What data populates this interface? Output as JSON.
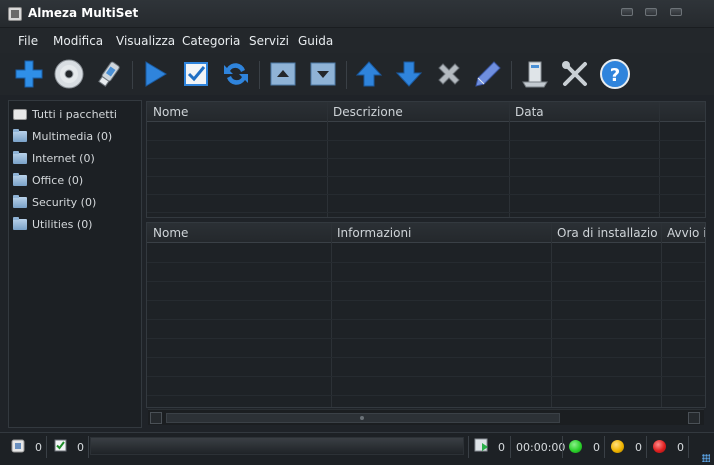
{
  "window": {
    "title": "Almeza MultiSet"
  },
  "menu": [
    "File",
    "Modifica",
    "Visualizza",
    "Categoria",
    "Servizi",
    "Guida"
  ],
  "toolbar": {
    "buttons": [
      "add-icon",
      "cd-icon",
      "usb-icon",
      "play-icon",
      "checkbox-icon",
      "refresh-icon",
      "move-top-icon",
      "move-bottom-icon",
      "arrow-up-icon",
      "arrow-down-icon",
      "delete-icon",
      "edit-icon",
      "computer-icon",
      "tools-icon",
      "help-icon"
    ]
  },
  "sidebar": {
    "items": [
      {
        "label": "Tutti i pacchetti",
        "icon": "package-icon"
      },
      {
        "label": "Multimedia (0)",
        "icon": "folder-icon"
      },
      {
        "label": "Internet (0)",
        "icon": "folder-icon"
      },
      {
        "label": "Office (0)",
        "icon": "folder-icon"
      },
      {
        "label": "Security (0)",
        "icon": "folder-icon"
      },
      {
        "label": "Utilities (0)",
        "icon": "folder-icon"
      }
    ]
  },
  "packages_table": {
    "columns": [
      "Nome",
      "Descrizione",
      "Data"
    ]
  },
  "install_table": {
    "columns": [
      "Nome",
      "Informazioni",
      "Ora di installazio...",
      "Avvio i"
    ]
  },
  "status": {
    "packages_count": "0",
    "checked_count": "0",
    "install_count": "0",
    "elapsed": "00:00:00",
    "success_count": "0",
    "warning_count": "0",
    "error_count": "0",
    "colors": {
      "success": "#2bd12b",
      "warning": "#f0b400",
      "error": "#e02020"
    }
  }
}
